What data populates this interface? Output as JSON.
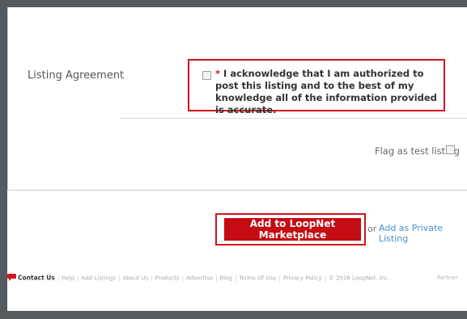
{
  "form": {
    "listing_label": "Listing Agreement",
    "required_marker": "* ",
    "agreement_text": "I acknowledge that I am authorized to post this listing and to the best of my knowledge all of the information provided is accurate.",
    "flag_label": "Flag as test listing"
  },
  "actions": {
    "submit_label": "Add to LoopNet Marketplace",
    "or_text": "or",
    "private_label": "Add as Private Listing"
  },
  "footer": {
    "contact_label": "Contact Us",
    "links": [
      "Help",
      "Add Listings",
      "About Us",
      "Products",
      "Advertise",
      "Blog",
      "Terms Of Use",
      "Privacy Policy"
    ],
    "copyright": "© 2016 LoopNet, Inc.",
    "partner_label": "Partner"
  },
  "colors": {
    "accent_red": "#c40c12",
    "link_blue": "#4a8fc9",
    "frame_gray": "#555a5e"
  }
}
